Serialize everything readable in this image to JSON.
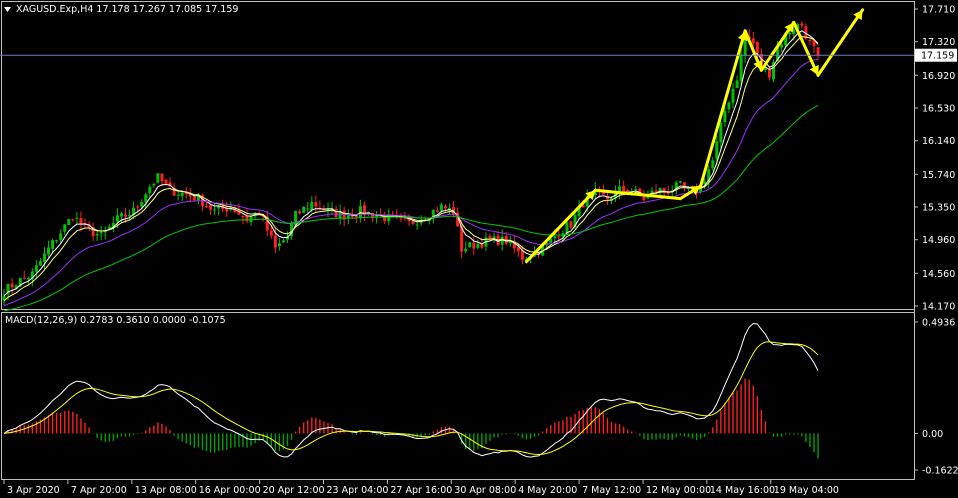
{
  "header": {
    "symbol_line": "XAGUSD.Exp,H4  17.178 17.267 17.085 17.159",
    "macd_line": "MACD(12,26,9) 0.2783 0.3610 0.0000 -0.1075"
  },
  "price_axis": {
    "ticks": [
      "17.710",
      "17.320",
      "16.920",
      "16.530",
      "16.140",
      "15.740",
      "15.350",
      "14.960",
      "14.560",
      "14.170"
    ],
    "current_price": "17.159"
  },
  "macd_axis": {
    "ticks": [
      "0.4936",
      "0.00",
      "-0.1622"
    ]
  },
  "time_axis": {
    "ticks": [
      "3 Apr 2020",
      "7 Apr 20:00",
      "13 Apr 08:00",
      "16 Apr 00:00",
      "20 Apr 12:00",
      "23 Apr 04:00",
      "27 Apr 16:00",
      "30 Apr 08:00",
      "4 May 20:00",
      "7 May 12:00",
      "12 May 00:00",
      "14 May 16:00",
      "19 May 04:00"
    ]
  },
  "colors": {
    "background": "#000000",
    "bull_candle": "#00c000",
    "bear_candle": "#ff2020",
    "ma_fast": "#ffffff",
    "ma_mid": "#ffff80",
    "ma_slow": "#9b30ff",
    "ma_long": "#00c800",
    "arrow": "#ffff00",
    "macd_main": "#ffffff",
    "macd_signal": "#ffff00",
    "hist_pos": "#ff2020",
    "hist_neg": "#00a000",
    "price_line": "#6b7fbf"
  },
  "chart_data": {
    "type": "candlestick",
    "symbol": "XAGUSD.Exp",
    "timeframe": "H4",
    "ylim": [
      14.17,
      17.71
    ],
    "last": 17.159,
    "close_path": [
      [
        0,
        14.35
      ],
      [
        3,
        14.45
      ],
      [
        7,
        14.55
      ],
      [
        11,
        14.85
      ],
      [
        14,
        15.05
      ],
      [
        17,
        15.25
      ],
      [
        20,
        15.1
      ],
      [
        24,
        15.0
      ],
      [
        28,
        15.2
      ],
      [
        32,
        15.3
      ],
      [
        36,
        15.6
      ],
      [
        38,
        15.7
      ],
      [
        41,
        15.55
      ],
      [
        45,
        15.5
      ],
      [
        48,
        15.45
      ],
      [
        52,
        15.3
      ],
      [
        56,
        15.35
      ],
      [
        60,
        15.2
      ],
      [
        63,
        15.3
      ],
      [
        67,
        14.85
      ],
      [
        70,
        15.0
      ],
      [
        72,
        15.25
      ],
      [
        76,
        15.4
      ],
      [
        80,
        15.3
      ],
      [
        84,
        15.25
      ],
      [
        88,
        15.3
      ],
      [
        92,
        15.25
      ],
      [
        96,
        15.2
      ],
      [
        100,
        15.15
      ],
      [
        104,
        15.25
      ],
      [
        108,
        15.35
      ],
      [
        111,
        15.3
      ],
      [
        113,
        14.85
      ],
      [
        116,
        14.9
      ],
      [
        120,
        14.95
      ],
      [
        124,
        14.95
      ],
      [
        128,
        14.75
      ],
      [
        131,
        14.8
      ],
      [
        134,
        14.9
      ],
      [
        137,
        15.05
      ],
      [
        140,
        15.15
      ],
      [
        143,
        15.4
      ],
      [
        146,
        15.5
      ],
      [
        149,
        15.45
      ],
      [
        152,
        15.55
      ],
      [
        155,
        15.55
      ],
      [
        158,
        15.45
      ],
      [
        161,
        15.55
      ],
      [
        164,
        15.55
      ],
      [
        167,
        15.6
      ],
      [
        170,
        15.5
      ],
      [
        172,
        15.6
      ],
      [
        175,
        15.9
      ],
      [
        178,
        16.5
      ],
      [
        181,
        16.9
      ],
      [
        183,
        17.4
      ],
      [
        185,
        17.3
      ],
      [
        187,
        17.0
      ],
      [
        189,
        16.95
      ],
      [
        191,
        17.25
      ],
      [
        193,
        17.4
      ],
      [
        195,
        17.5
      ],
      [
        197,
        17.52
      ],
      [
        199,
        17.3
      ],
      [
        201,
        17.159
      ]
    ],
    "ma_periods": [
      5,
      8,
      21,
      50
    ],
    "macd": {
      "params": [
        12,
        26,
        9
      ],
      "main": 0.2783,
      "signal": 0.361,
      "histogram": -0.1075,
      "ylim": [
        -0.1622,
        0.4936
      ]
    },
    "annotations": [
      {
        "type": "arrow",
        "from": [
          129,
          14.7
        ],
        "to": [
          146,
          15.55
        ]
      },
      {
        "type": "line",
        "from": [
          146,
          15.55
        ],
        "to": [
          167,
          15.45
        ]
      },
      {
        "type": "arrow",
        "from": [
          167,
          15.45
        ],
        "to": [
          172,
          15.6
        ]
      },
      {
        "type": "arrow",
        "from": [
          172,
          15.6
        ],
        "to": [
          183,
          17.45
        ]
      },
      {
        "type": "arrow",
        "from": [
          183,
          17.45
        ],
        "to": [
          187,
          16.98
        ]
      },
      {
        "type": "arrow",
        "from": [
          187,
          16.98
        ],
        "to": [
          195,
          17.55
        ]
      },
      {
        "type": "arrow",
        "from": [
          195,
          17.55
        ],
        "to": [
          201,
          16.92
        ]
      },
      {
        "type": "arrow",
        "from": [
          201,
          16.92
        ],
        "to": [
          212,
          17.7
        ]
      }
    ]
  }
}
